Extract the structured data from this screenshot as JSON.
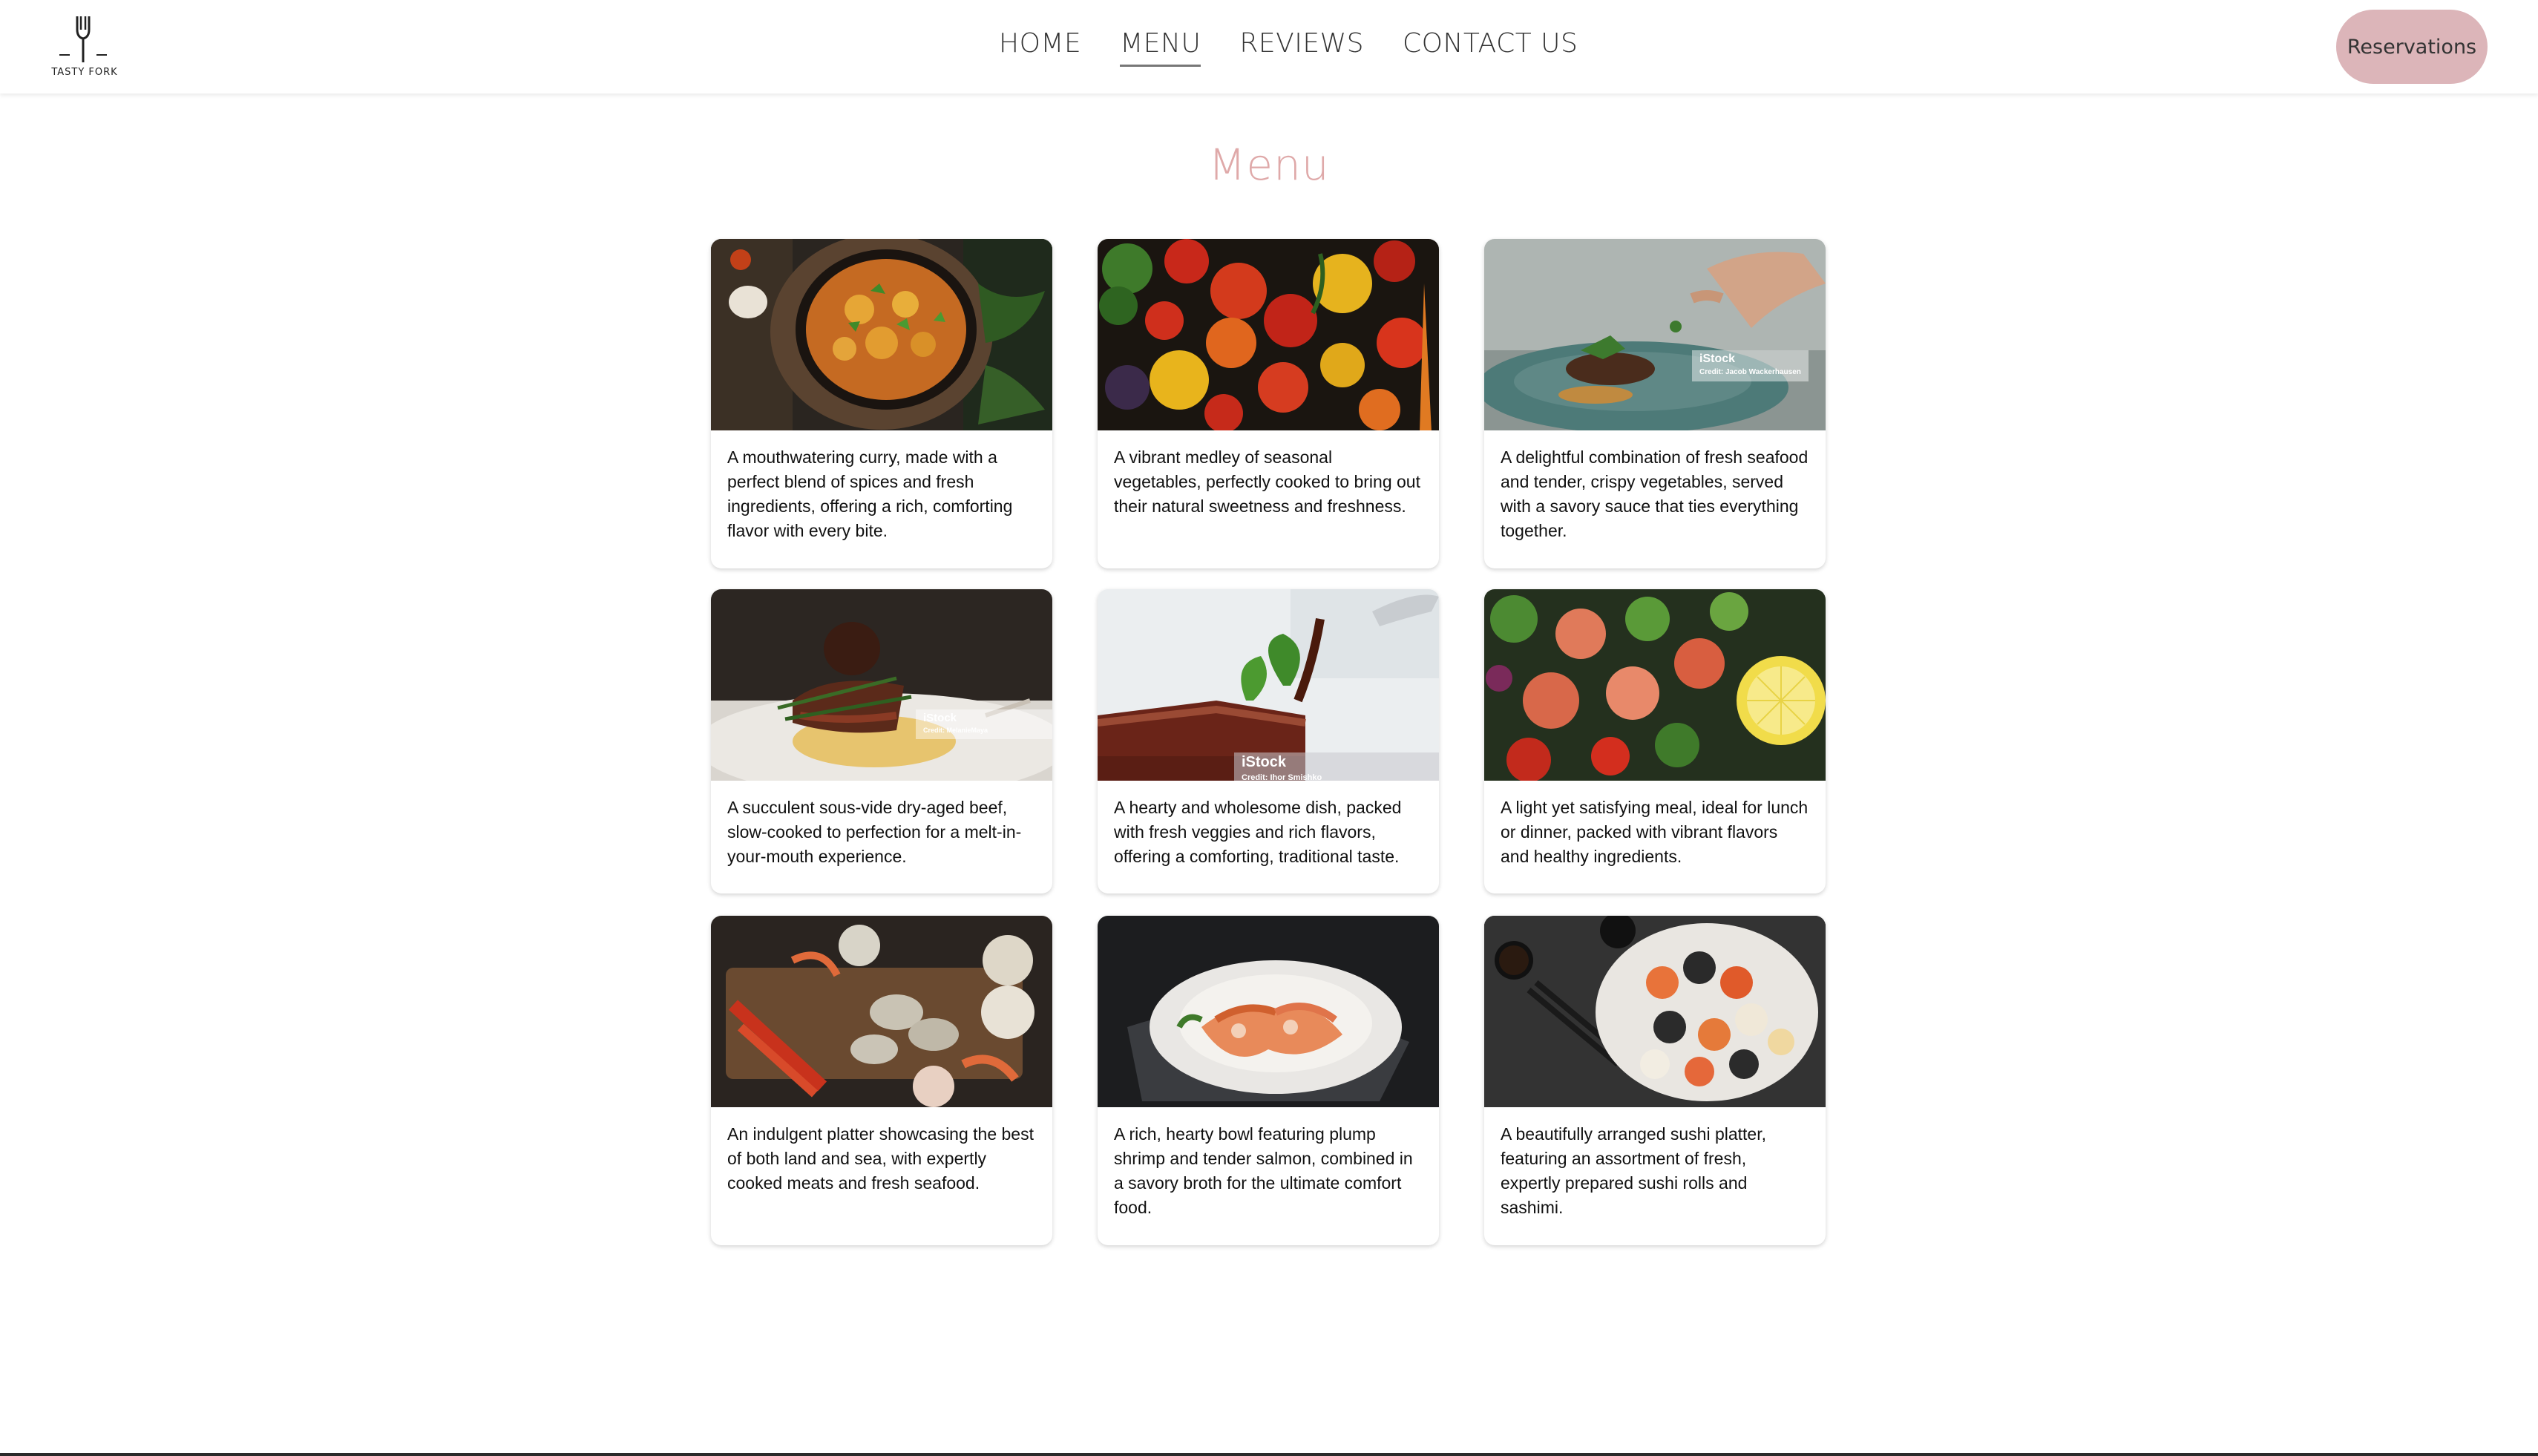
{
  "brand": {
    "name": "TASTY FORK"
  },
  "nav": {
    "items": [
      {
        "label": "HOME",
        "active": false
      },
      {
        "label": "MENU",
        "active": true
      },
      {
        "label": "REVIEWS",
        "active": false
      },
      {
        "label": "CONTACT US",
        "active": false
      }
    ]
  },
  "header": {
    "reservations_label": "Reservations"
  },
  "main": {
    "title": "Menu"
  },
  "colors": {
    "accent": "#dfa9a9",
    "button": "#dcb5b9",
    "text": "#111111"
  },
  "menu": {
    "items": [
      {
        "image": "curry-photo",
        "description": "A mouthwatering curry, made with a perfect blend of spices and fresh ingredients, offering a rich, comforting flavor with every bite."
      },
      {
        "image": "vegetables-photo",
        "description": "A vibrant medley of seasonal vegetables, perfectly cooked to bring out their natural sweetness and freshness."
      },
      {
        "image": "seafood-plating-photo",
        "description": "A delightful combination of fresh seafood and tender, crispy vegetables, served with a savory sauce that ties everything together.",
        "watermark": "iStock",
        "credit": "Credit: Jacob Wackerhausen"
      },
      {
        "image": "beef-photo",
        "description": "A succulent sous-vide dry-aged beef, slow-cooked to perfection for a melt-in-your-mouth experience.",
        "watermark": "iStock",
        "credit": "Credit: MelanieMaya"
      },
      {
        "image": "steak-sauce-photo",
        "description": "A hearty and wholesome dish, packed with fresh veggies and rich flavors, offering a comforting, traditional taste.",
        "watermark": "iStock",
        "credit": "Credit: Ihor Smishko"
      },
      {
        "image": "salmon-salad-photo",
        "description": "A light yet satisfying meal, ideal for lunch or dinner, packed with vibrant flavors and healthy ingredients."
      },
      {
        "image": "seafood-platter-photo",
        "description": "An indulgent platter showcasing the best of both land and sea, with expertly cooked meats and fresh seafood."
      },
      {
        "image": "shrimp-salmon-photo",
        "description": "A rich, hearty bowl featuring plump shrimp and tender salmon, combined in a savory broth for the ultimate comfort food."
      },
      {
        "image": "sushi-photo",
        "description": "A beautifully arranged sushi platter, featuring an assortment of fresh, expertly prepared sushi rolls and sashimi."
      }
    ]
  }
}
